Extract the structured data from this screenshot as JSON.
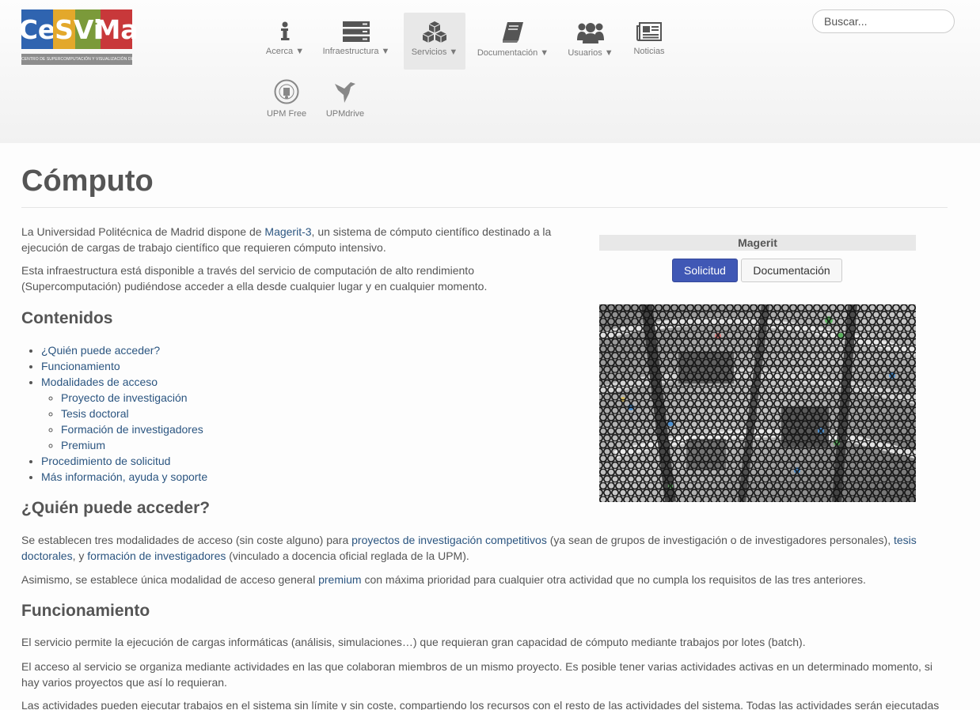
{
  "logo": {
    "letters": [
      "Ce",
      "S",
      "Vi",
      "Ma"
    ],
    "letter_colors": [
      "#2f64b0",
      "#e3a82b",
      "#7b9a3a",
      "#c8383a"
    ],
    "tagline": "CENTRO DE SUPERCOMPUTACIÓN Y VISUALIZACIÓN DE MADRID"
  },
  "nav": [
    {
      "label": "Acerca ▼",
      "icon": "info-icon"
    },
    {
      "label": "Infraestructura ▼",
      "icon": "server-icon"
    },
    {
      "label": "Servicios ▼",
      "icon": "cubes-icon",
      "active": true
    },
    {
      "label": "Documentación ▼",
      "icon": "book-icon"
    },
    {
      "label": "Usuarios ▼",
      "icon": "users-icon"
    },
    {
      "label": "Noticias",
      "icon": "newspaper-icon"
    },
    {
      "label": "UPM Free",
      "icon": "upm-seal-icon"
    },
    {
      "label": "UPMdrive",
      "icon": "bird-icon"
    }
  ],
  "search": {
    "placeholder": "Buscar..."
  },
  "page": {
    "title": "Cómputo",
    "intro1_a": "La Universidad Politécnica de Madrid dispone de ",
    "intro1_link": "Magerit-3",
    "intro1_b": ", un sistema de cómputo científico destinado a la",
    "intro1_c": "ejecución de cargas de trabajo científico que requieren cómputo intensivo.",
    "intro2_a": "Esta infraestructura está disponible a través del servicio de computación de alto rendimiento",
    "intro2_b": "(Supercomputación) pudiéndose acceder a ella desde cualquier lugar y en cualquier momento.",
    "contents_heading": "Contenidos",
    "toc": {
      "who": "¿Quién puede acceder?",
      "how": "Funcionamiento",
      "modes": "Modalidades de acceso",
      "sub": [
        "Proyecto de investigación",
        "Tesis doctoral",
        "Formación de investigadores",
        "Premium"
      ],
      "procedure": "Procedimiento de solicitud",
      "more": "Más información, ayuda y soporte"
    },
    "who_heading": "¿Quién puede acceder?",
    "who_p1_a": "Se establecen tres modalidades de acceso (sin coste alguno) para ",
    "who_p1_link1": "proyectos de investigación competitivos",
    "who_p1_b": " (ya sean de grupos de investigación o de investigadores personales), ",
    "who_p1_link2a": "tesis",
    "who_p1_link2b": "doctorales",
    "who_p1_c": ", y ",
    "who_p1_link3": "formación de investigadores",
    "who_p1_d": " (vinculado a docencia oficial reglada de la UPM).",
    "who_p2_a": "Asimismo, se establece única modalidad de acceso general ",
    "who_p2_link": "premium",
    "who_p2_b": " con máxima prioridad para cualquier otra actividad que no cumpla los requisitos de las tres anteriores.",
    "func_heading": "Funcionamiento",
    "func_p1": "El servicio permite la ejecución de cargas informáticas (análisis, simulaciones…) que requieran gran capacidad de cómputo mediante trabajos por lotes (batch).",
    "func_p2_a": "El acceso al servicio se organiza mediante actividades en las que colaboran miembros de un mismo proyecto. Es posible tener varias actividades activas en un determinado momento, si",
    "func_p2_b": "hay varios proyectos que así lo requieran.",
    "func_p3": "Las actividades pueden ejecutar trabajos en el sistema sin límite y sin coste, compartiendo los recursos con el resto de las actividades del sistema. Todas las actividades serán ejecutadas"
  },
  "sidebar": {
    "title": "Magerit",
    "btn_request": "Solicitud",
    "btn_docs": "Documentación"
  },
  "colors": {
    "link": "#2b5580",
    "primary": "#4058b5"
  }
}
